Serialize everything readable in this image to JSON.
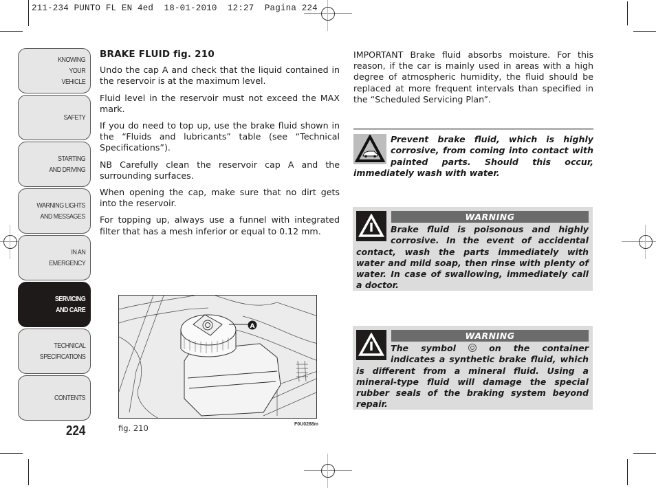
{
  "print_header": "211-234 PUNTO FL EN 4ed  18-01-2010  12:27  Pagina 224",
  "sidebar": {
    "tabs": [
      {
        "label": "KNOWING\nYOUR\nVEHICLE",
        "active": false
      },
      {
        "label": "SAFETY",
        "active": false
      },
      {
        "label": "STARTING\nAND DRIVING",
        "active": false
      },
      {
        "label": "WARNING LIGHTS\nAND MESSAGES",
        "active": false
      },
      {
        "label": "IN AN\nEMERGENCY",
        "active": false
      },
      {
        "label": "SERVICING\nAND CARE",
        "active": true
      },
      {
        "label": "TECHNICAL\nSPECIFICATIONS",
        "active": false
      },
      {
        "label": "CONTENTS",
        "active": false
      }
    ],
    "page_number": "224"
  },
  "left_column": {
    "heading": "BRAKE FLUID fig. 210",
    "paragraphs": [
      "Undo the cap A and check that the liquid contained in the reservoir is at the maximum level.",
      "Fluid level in the reservoir must not exceed the MAX mark.",
      "If you do need to top up, use the brake fluid shown in the “Fluids and lubricants” table (see “Technical Specifications”).",
      "NB Carefully clean the reservoir cap A and the surrounding surfaces.",
      "When opening the cap, make sure that no dirt gets into the reservoir.",
      "For topping up, always use a funnel with integrated filter that has a mesh inferior or equal to 0.12 mm."
    ]
  },
  "figure": {
    "callout_label": "A",
    "caption": "fig. 210",
    "code": "F0U0288m"
  },
  "right_column": {
    "important": "IMPORTANT Brake fluid absorbs moisture. For this reason, if the car is mainly used in areas with a high degree of atmospheric humidity, the fluid should be replaced at more frequent intervals than specified in the “Scheduled Servicing Plan”.",
    "caution": {
      "icon": "car-paint-caution-icon",
      "text": "Prevent brake fluid, which is highly corrosive, from coming into contact with painted parts. Should this occur, immediately wash with water."
    },
    "warnings": [
      {
        "title": "WARNING",
        "icon": "warning-triangle-icon",
        "text": "Brake fluid is poisonous and highly corrosive. In the event of accidental contact, wash the parts immediately with water and mild soap, then rinse with plenty of water. In case of swallowing, immediately call a doctor."
      },
      {
        "title": "WARNING",
        "icon": "warning-triangle-icon",
        "text_before_symbol": "The symbol ",
        "symbol": "synthetic-fluid-symbol",
        "text_after_symbol": " on the container indicates a synthetic brake fluid, which is different from a mineral fluid. Using a mineral-type fluid will damage the special rubber seals of the braking system beyond repair."
      }
    ]
  }
}
